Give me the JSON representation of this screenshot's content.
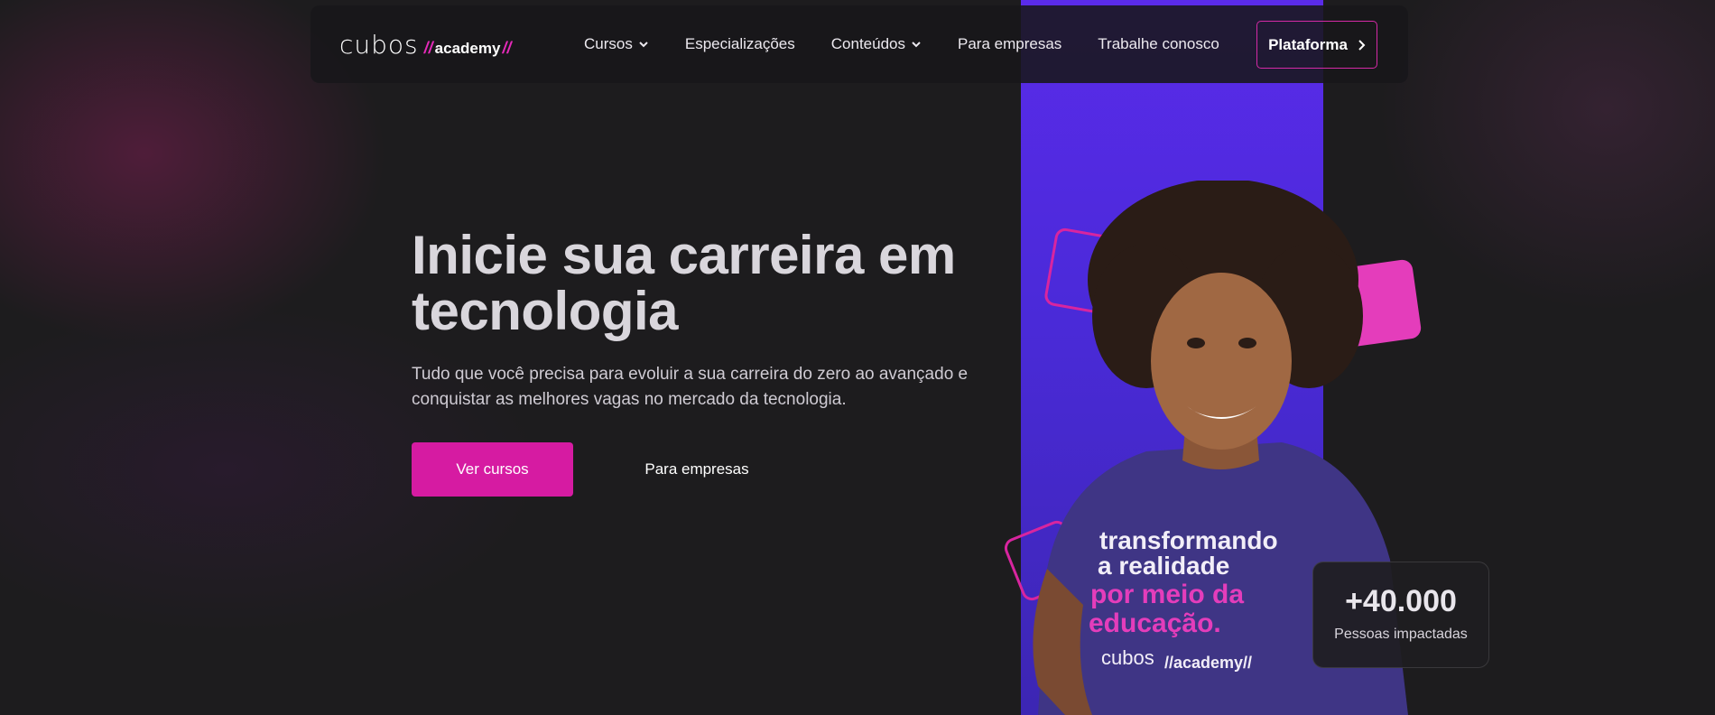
{
  "brand": {
    "logo_main": "cubos",
    "logo_slash": "//",
    "logo_sub": "academy",
    "accent": "#d61ba2",
    "panel": "#5a2bea"
  },
  "nav": {
    "items": [
      {
        "label": "Cursos",
        "has_dropdown": true
      },
      {
        "label": "Especializações",
        "has_dropdown": false
      },
      {
        "label": "Conteúdos",
        "has_dropdown": true
      },
      {
        "label": "Para empresas",
        "has_dropdown": false
      },
      {
        "label": "Trabalhe conosco",
        "has_dropdown": false
      }
    ],
    "cta_label": "Plataforma",
    "cta_icon": "chevron-right-icon"
  },
  "hero": {
    "title": "Inicie sua carreira em tecnologia",
    "subtitle": "Tudo que você precisa para evoluir a sua carreira do zero ao avançado e conquistar as melhores vagas no mercado da tecnologia.",
    "primary_button": "Ver cursos",
    "secondary_button": "Para empresas"
  },
  "stat": {
    "value": "+40.000",
    "label": "Pessoas impactadas"
  },
  "shirt": {
    "line1": "transformando",
    "line2": "a realidade",
    "line3": "por meio da",
    "line4": "educação.",
    "brand_main": "cubos",
    "brand_sub": "//academy//"
  }
}
